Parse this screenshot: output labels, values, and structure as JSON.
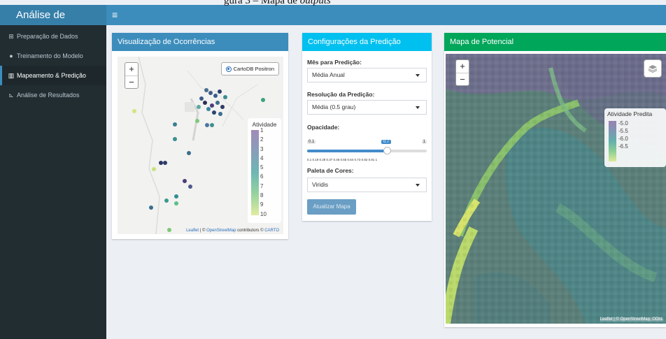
{
  "caption": {
    "prefix": "gura 3 – Mapa de ",
    "italic": "outputs"
  },
  "app": {
    "title": "Análise de Atividade",
    "menu_icon": "hamburger-icon"
  },
  "sidebar": {
    "items": [
      {
        "label": "Preparação de Dados",
        "icon": "table-icon",
        "active": false
      },
      {
        "label": "Treinamento do Modelo",
        "icon": "brain-icon",
        "active": false
      },
      {
        "label": "Mapeamento & Predição",
        "icon": "map-icon",
        "active": true
      },
      {
        "label": "Análise de Resultados",
        "icon": "chart-icon",
        "active": false
      }
    ]
  },
  "panel_occurrences": {
    "title": "Visualização de Ocorrências",
    "zoom_in": "+",
    "zoom_out": "−",
    "basemap_option": "CartoDB Positron",
    "legend_title": "Atividade",
    "legend_ticks": [
      "1",
      "2",
      "3",
      "4",
      "5",
      "6",
      "7",
      "8",
      "9",
      "10"
    ],
    "attribution": {
      "leaflet": "Leaflet",
      "sep1": " | © ",
      "osm": "OpenStreetMap",
      "contrib": " contributors © ",
      "carto": "CARTO"
    }
  },
  "panel_config": {
    "title": "Configurações da Predição",
    "month_label": "Mês para Predição:",
    "month_value": "Média Anual",
    "resolution_label": "Resolução da Predição:",
    "resolution_value": "Média (0.5 grau)",
    "opacity_label": "Opacidade:",
    "opacity": {
      "min": "0.1",
      "max": "1",
      "value": "0.7",
      "fraction": 0.667,
      "ticks": "0.1  0.19  0.28  0.37  0.46  0.55  0.64  0.73  0.82  0.91  1"
    },
    "palette_label": "Paleta de Cores:",
    "palette_value": "Viridis",
    "update_button": "Atualizar Mapa"
  },
  "panel_potential": {
    "title": "Mapa de Potencial",
    "zoom_in": "+",
    "zoom_out": "−",
    "legend_title": "Atividade Predita",
    "legend_ticks": [
      "-5.0",
      "-5.5",
      "-6.0",
      "-6.5"
    ],
    "attribution": "Leaflet | © OpenStreetMap, ODbL"
  },
  "colors": {
    "brand": "#367fa9",
    "topbar": "#3c8dbc",
    "sidebar": "#222d32",
    "config_header": "#00c0ef",
    "potential_header": "#00a65a"
  }
}
